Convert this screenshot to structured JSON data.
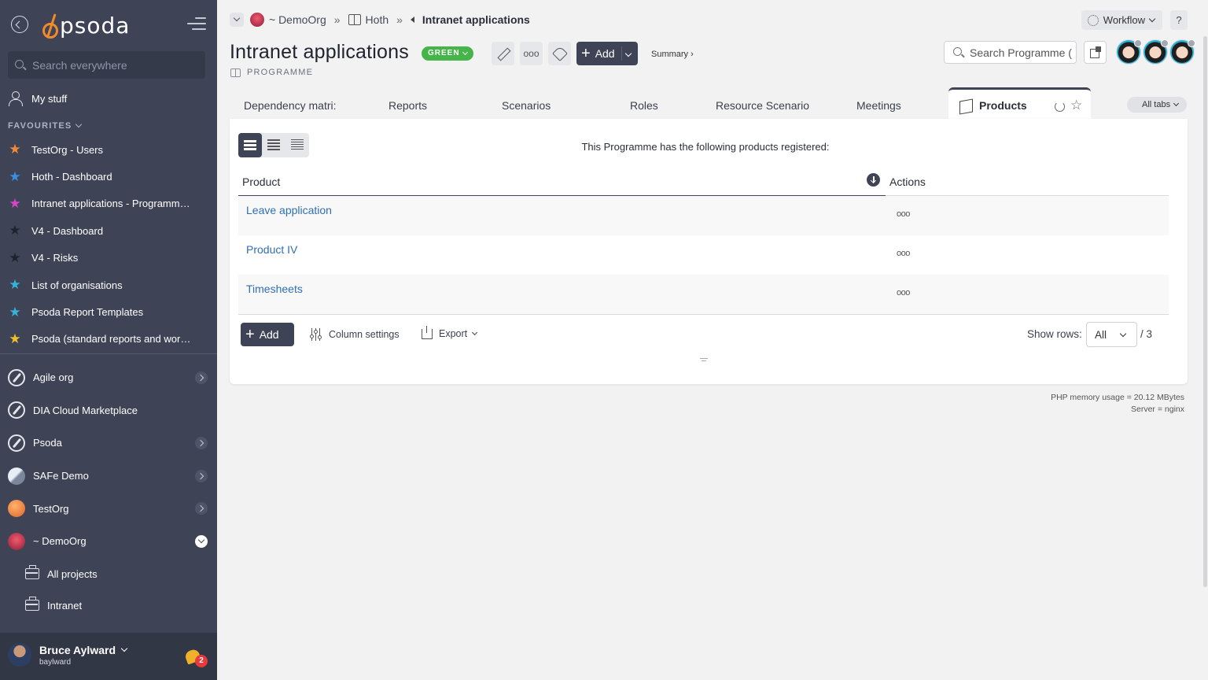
{
  "sidebar": {
    "logo_text": "psoda",
    "search_placeholder": "Search everywhere",
    "my_stuff": "My stuff",
    "favourites_heading": "FAVOURITES",
    "favourites": [
      {
        "label": "TestOrg - Users",
        "color": "#f08a3a"
      },
      {
        "label": "Hoth - Dashboard",
        "color": "#3a8ee6"
      },
      {
        "label": "Intranet applications - Programme...",
        "color": "#d845c8"
      },
      {
        "label": "V4 - Dashboard",
        "color": "#1f2330"
      },
      {
        "label": "V4 - Risks",
        "color": "#1f2330"
      },
      {
        "label": "List of organisations",
        "color": "#35b3d8"
      },
      {
        "label": "Psoda Report Templates",
        "color": "#35b3d8"
      },
      {
        "label": "Psoda (standard reports and work...",
        "color": "#f0c02a"
      }
    ],
    "orgs": [
      {
        "label": "Agile org",
        "icon": "compass"
      },
      {
        "label": "DIA Cloud Marketplace",
        "icon": "compass"
      },
      {
        "label": "Psoda",
        "icon": "compass"
      },
      {
        "label": "SAFe Demo",
        "icon": "safe"
      },
      {
        "label": "TestOrg",
        "icon": "test"
      },
      {
        "label": "~ DemoOrg",
        "icon": "demo"
      }
    ],
    "sub_items": [
      "All projects",
      "Intranet"
    ],
    "user": {
      "name": "Bruce Aylward",
      "login": "baylward",
      "notifications": "2"
    }
  },
  "breadcrumb": {
    "org": "~ DemoOrg",
    "parent": "Hoth",
    "current": "Intranet applications"
  },
  "header": {
    "workflow": "Workflow",
    "help": "?",
    "title": "Intranet applications",
    "status": "GREEN",
    "status_color": "#45b549",
    "type": "PROGRAMME",
    "add": "Add",
    "summary": "Summary ›",
    "search_placeholder": "Search Programme (",
    "dots": "ooo"
  },
  "tabs": {
    "items": [
      "Dependency matri:",
      "Reports",
      "Scenarios",
      "Roles",
      "Resource Scenario:",
      "Meetings"
    ],
    "active": "Products",
    "all_tabs": "All tabs"
  },
  "panel": {
    "message": "This Programme has the following products registered:",
    "columns": {
      "product": "Product",
      "actions": "Actions"
    },
    "rows": [
      {
        "product": "Leave application",
        "actions": "ooo"
      },
      {
        "product": "Product IV",
        "actions": "ooo"
      },
      {
        "product": "Timesheets",
        "actions": "ooo"
      }
    ],
    "add": "Add",
    "column_settings": "Column settings",
    "export": "Export",
    "show_rows_label": "Show rows:",
    "show_rows_value": "All",
    "rows_total": "/ 3"
  },
  "footer": {
    "memory": "PHP memory usage = 20.12 MBytes",
    "server": "Server = nginx"
  }
}
